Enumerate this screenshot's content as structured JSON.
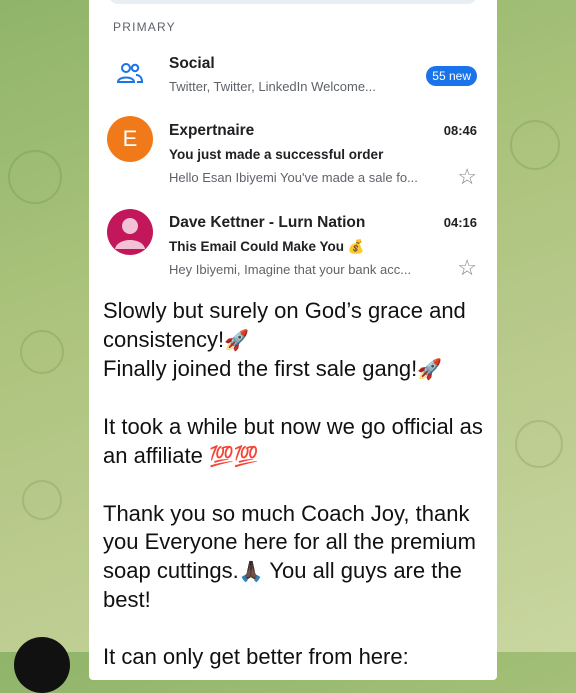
{
  "inbox": {
    "section_label": "PRIMARY",
    "rows": [
      {
        "sender": "Social",
        "snippet": "Twitter, Twitter, LinkedIn Welcome...",
        "badge": "55 new",
        "icon": "people-icon"
      },
      {
        "sender": "Expertnaire",
        "avatar_letter": "E",
        "avatar_color": "#f07a1a",
        "time": "08:46",
        "subject": "You just made a successful order",
        "snippet": "Hello Esan Ibiyemi You've made a sale fo...",
        "star": "☆"
      },
      {
        "sender": "Dave Kettner - Lurn Nation",
        "avatar_color": "#c2185b",
        "time": "04:16",
        "subject": "This Email Could Make You",
        "subject_emoji": "💰",
        "snippet": "Hey Ibiyemi, Imagine that your bank acc...",
        "star": "☆"
      }
    ]
  },
  "message": {
    "line1": "Slowly but surely on God’s grace and consistency!",
    "line1_emoji": "🚀",
    "line2": "Finally joined the first sale gang!",
    "line2_emoji": "🚀",
    "para2": "It took a while but now we go official as an affiliate",
    "para2_emoji": "💯💯",
    "para3_a": "Thank you so much Coach Joy, thank you Everyone here for all the premium soap cuttings.",
    "para3_emoji": "🙏🏿",
    "para3_b": " You all guys are the best!",
    "para4": "It can only get better from here:"
  },
  "colors": {
    "badge": "#1a73e8",
    "background": "#a9c27a"
  }
}
